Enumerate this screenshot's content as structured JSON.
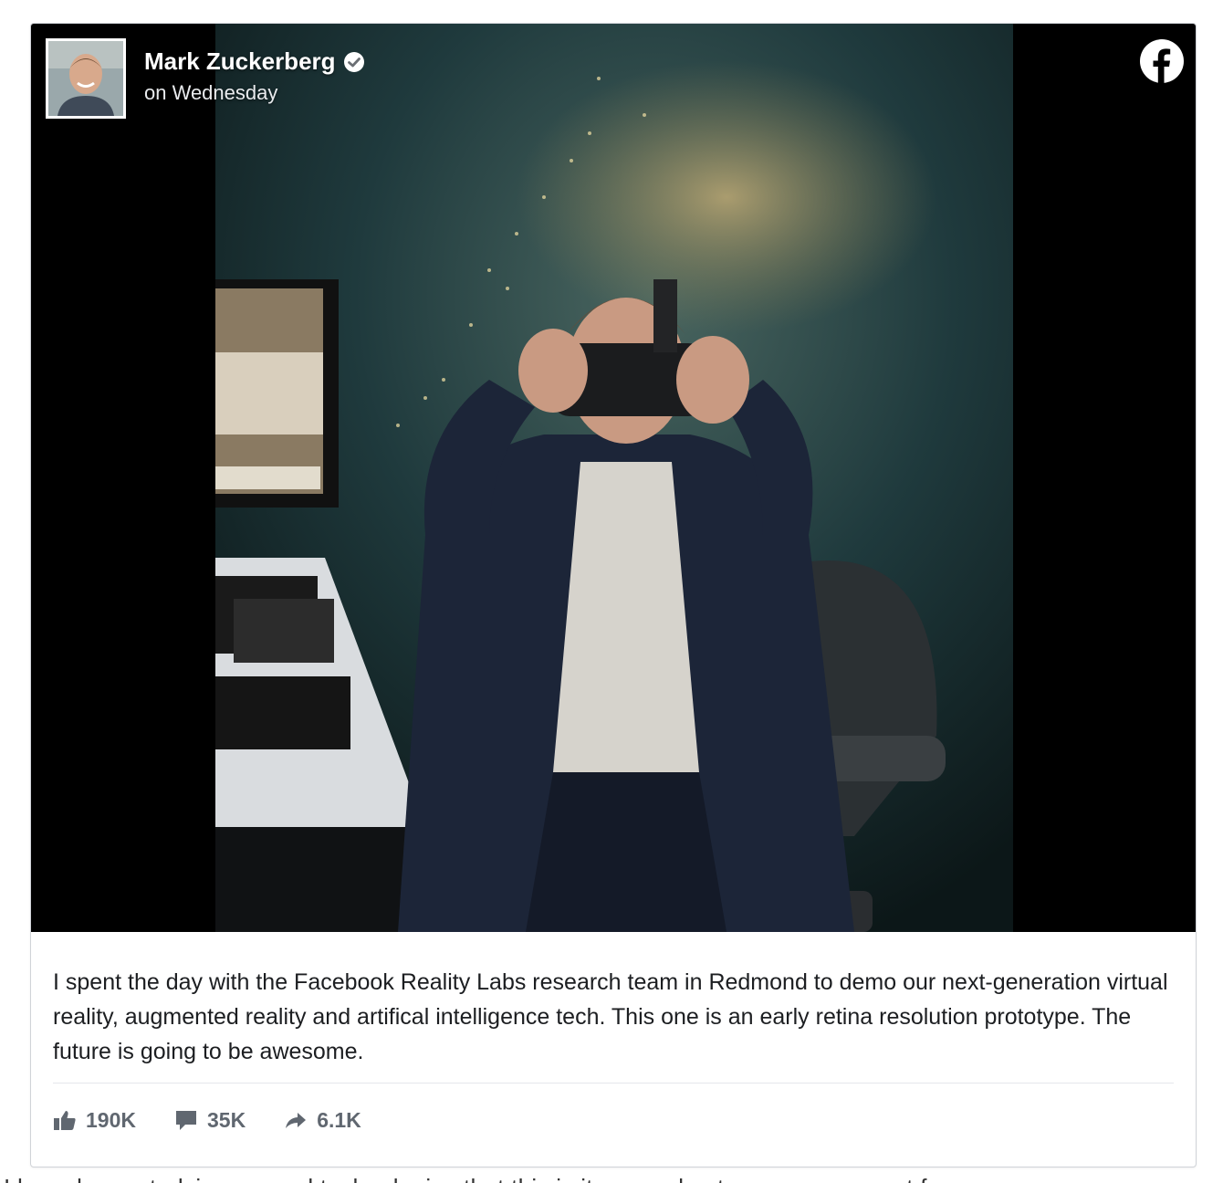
{
  "post": {
    "author": "Mark Zuckerberg",
    "timestamp": "on Wednesday",
    "caption": "I spent the day with the Facebook Reality Labs research team in Redmond to demo our next-generation virtual reality, augmented reality and artifical intelligence tech. This one is an early retina resolution prototype. The future is going to be awesome.",
    "icons": {
      "verified": "verified-badge-icon",
      "brand": "facebook-logo-icon",
      "like": "thumbs-up-icon",
      "comment": "comment-bubble-icon",
      "share": "share-arrow-icon"
    }
  },
  "stats": {
    "likes": "190K",
    "comments": "35K",
    "shares": "6.1K"
  },
  "colors": {
    "stat_text": "#606770",
    "caption_text": "#1c1e21",
    "border": "#d0d3d8"
  },
  "below_text": "I  have  been  studying  several  technologies  that  this  is  it  across  best  ease  more  agent  for"
}
